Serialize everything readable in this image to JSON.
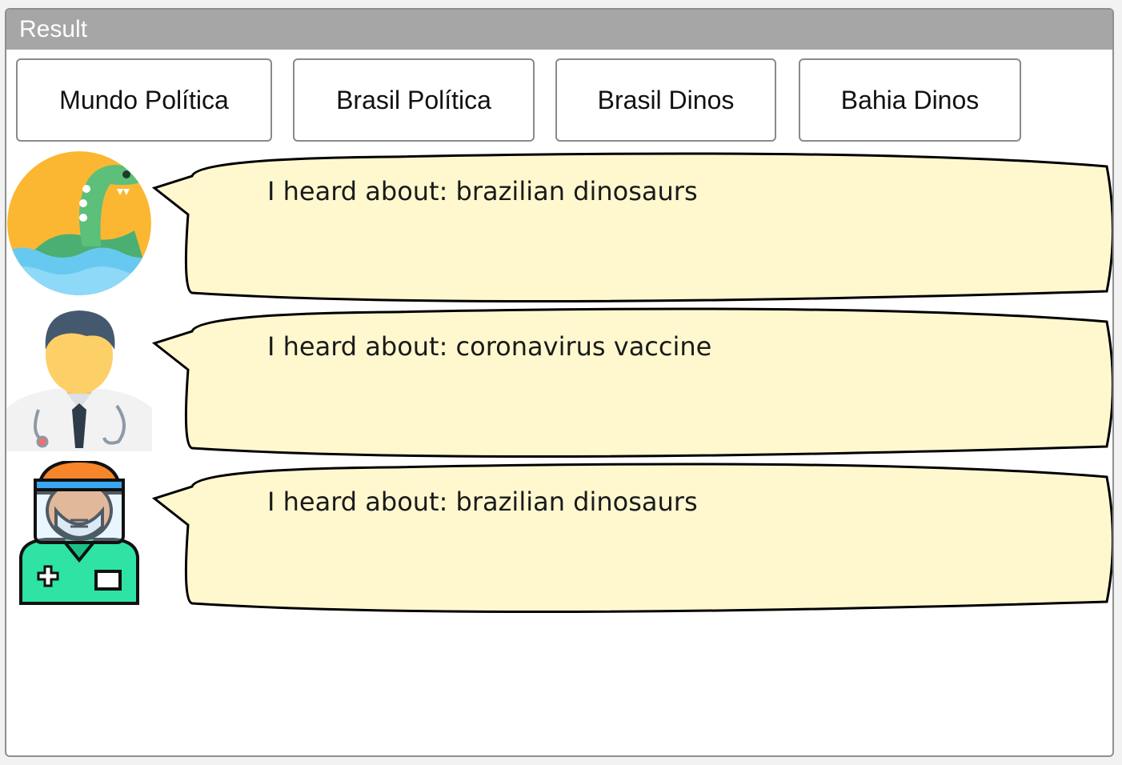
{
  "panel": {
    "title": "Result"
  },
  "topics": [
    {
      "label": "Mundo Política"
    },
    {
      "label": "Brasil Política"
    },
    {
      "label": "Brasil Dinos"
    },
    {
      "label": "Bahia Dinos"
    }
  ],
  "messages": [
    {
      "avatar": "dinosaur-icon",
      "text": "I heard about: brazilian dinosaurs"
    },
    {
      "avatar": "doctor-icon",
      "text": "I heard about: coronavirus vaccine"
    },
    {
      "avatar": "nurse-face-shield-icon",
      "text": "I heard about: brazilian dinosaurs"
    }
  ],
  "colors": {
    "header_bg": "#a6a6a6",
    "bubble_fill": "#fff8cf",
    "bubble_stroke": "#000000",
    "button_border": "#8a8a8a"
  }
}
